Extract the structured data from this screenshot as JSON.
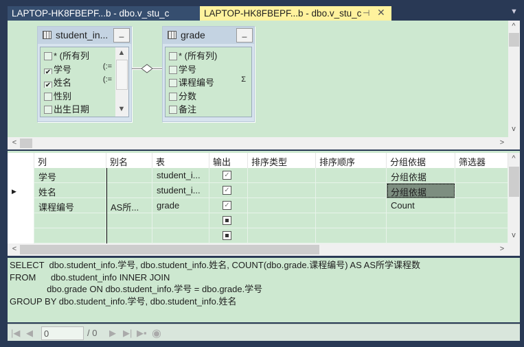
{
  "tabs": [
    {
      "label": "LAPTOP-HK8FBEPF...b - dbo.v_stu_c",
      "active": false
    },
    {
      "label": "LAPTOP-HK8FBEPF...b - dbo.v_stu_c",
      "active": true
    }
  ],
  "diagram": {
    "tables": [
      {
        "name": "student_in...",
        "fields": [
          {
            "label": "* (所有列",
            "checked": false
          },
          {
            "label": "学号",
            "checked": true,
            "marker": "(:="
          },
          {
            "label": "姓名",
            "checked": true,
            "marker": "(:="
          },
          {
            "label": "性别",
            "checked": false
          },
          {
            "label": "出生日期",
            "checked": false
          }
        ]
      },
      {
        "name": "grade",
        "fields": [
          {
            "label": "* (所有列)",
            "checked": false
          },
          {
            "label": "学号",
            "checked": false
          },
          {
            "label": "课程编号",
            "checked": false,
            "marker": "Σ"
          },
          {
            "label": "分数",
            "checked": false
          },
          {
            "label": "备注",
            "checked": false
          }
        ]
      }
    ]
  },
  "grid": {
    "headers": [
      "列",
      "别名",
      "表",
      "输出",
      "排序类型",
      "排序顺序",
      "分组依据",
      "筛选器"
    ],
    "rows": [
      {
        "column": "学号",
        "alias": "",
        "table": "student_i...",
        "output": "checked",
        "group_by": "分组依据"
      },
      {
        "column": "姓名",
        "alias": "",
        "table": "student_i...",
        "output": "checked",
        "group_by": "分组依据",
        "current": true
      },
      {
        "column": "课程编号",
        "alias": "AS所...",
        "table": "grade",
        "output": "checked",
        "group_by": "Count"
      },
      {
        "column": "",
        "alias": "",
        "table": "",
        "output": "indeterminate",
        "group_by": ""
      },
      {
        "column": "",
        "alias": "",
        "table": "",
        "output": "indeterminate",
        "group_by": ""
      }
    ]
  },
  "sql": {
    "lines": [
      "SELECT  dbo.student_info.学号, dbo.student_info.姓名, COUNT(dbo.grade.课程编号) AS AS所学课程数",
      "FROM      dbo.student_info INNER JOIN",
      "               dbo.grade ON dbo.student_info.学号 = dbo.grade.学号",
      "GROUP BY dbo.student_info.学号, dbo.student_info.姓名"
    ]
  },
  "nav": {
    "current": "0",
    "total": "/ 0"
  },
  "colors": {
    "frame": "#293955",
    "pane": "#cde8d0",
    "active_tab": "#fff29d"
  }
}
